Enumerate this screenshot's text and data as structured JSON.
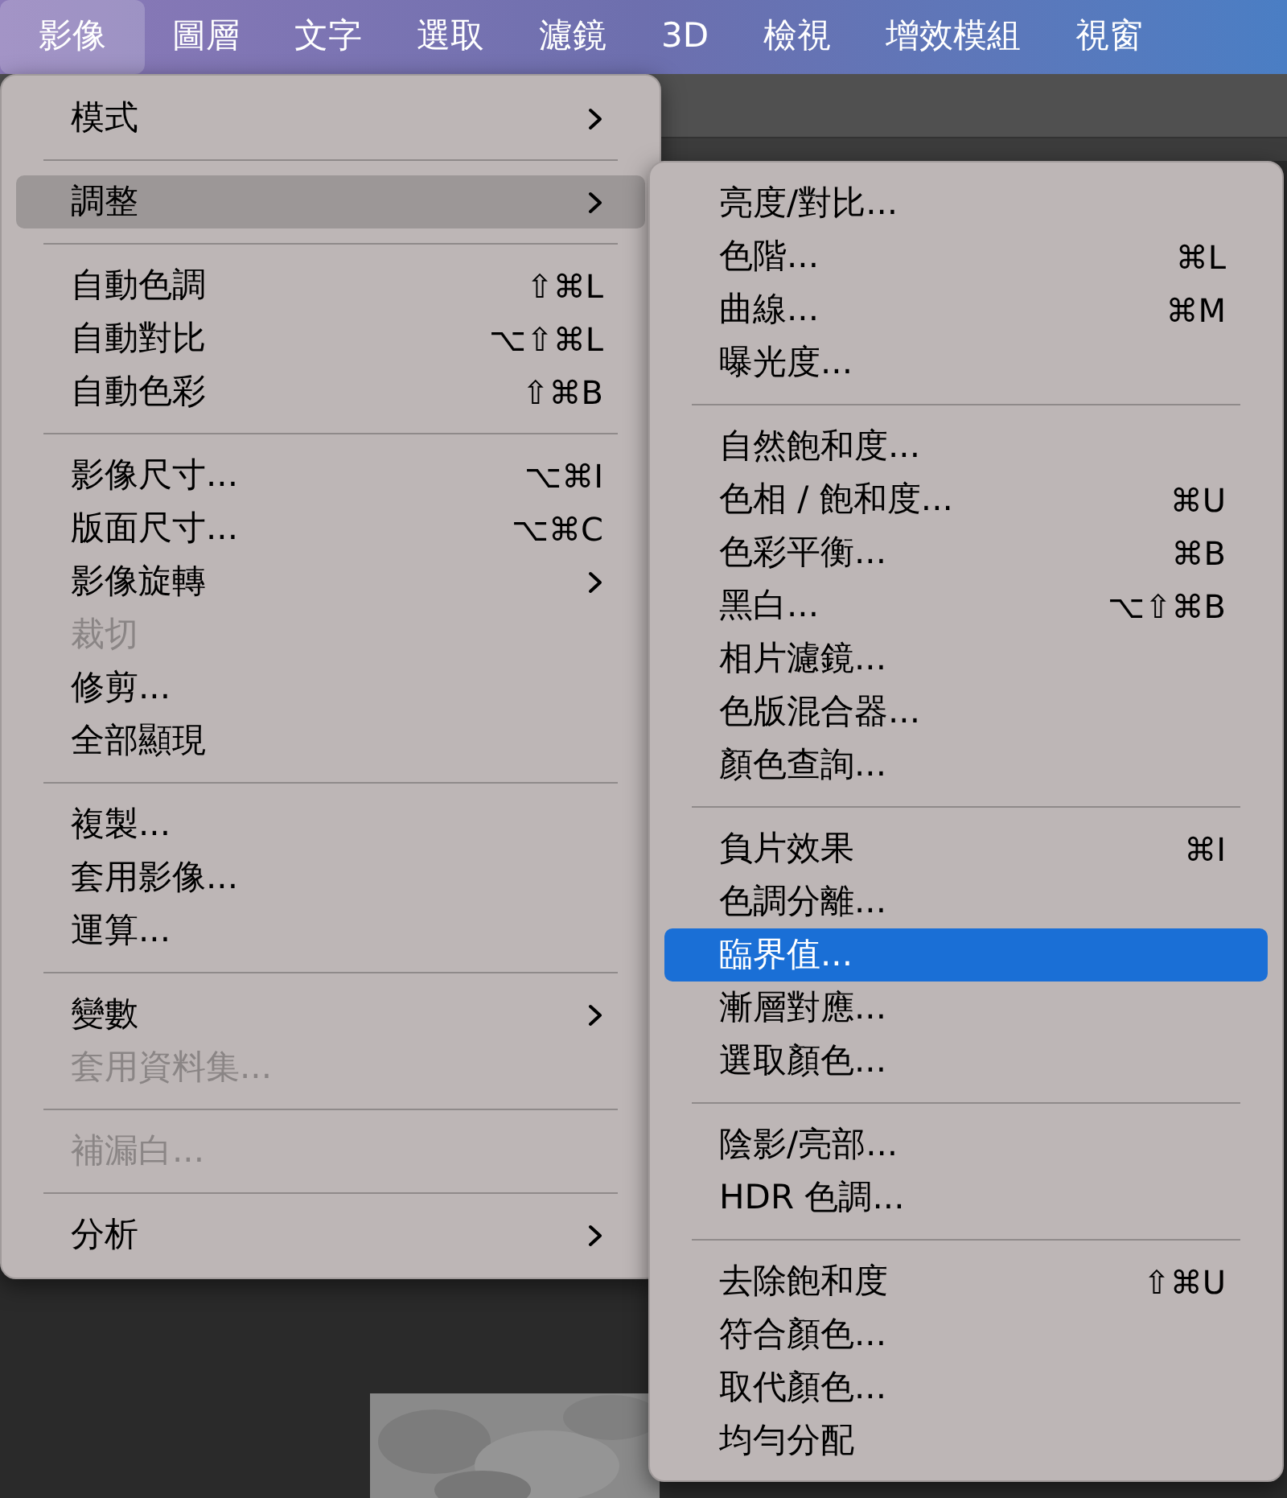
{
  "menu_bar": [
    {
      "label": "影像",
      "selected": true
    },
    {
      "label": "圖層",
      "selected": false
    },
    {
      "label": "文字",
      "selected": false
    },
    {
      "label": "選取",
      "selected": false
    },
    {
      "label": "濾鏡",
      "selected": false
    },
    {
      "label": "3D",
      "selected": false
    },
    {
      "label": "檢視",
      "selected": false
    },
    {
      "label": "增效模組",
      "selected": false
    },
    {
      "label": "視窗",
      "selected": false
    }
  ],
  "menu": {
    "items": [
      {
        "kind": "item",
        "label": "模式",
        "has_submenu": true,
        "selected": false,
        "disabled": false
      },
      {
        "kind": "separator"
      },
      {
        "kind": "item",
        "label": "調整",
        "has_submenu": true,
        "selected": true,
        "disabled": false
      },
      {
        "kind": "separator"
      },
      {
        "kind": "item",
        "label": "自動色調",
        "shortcut": "⇧⌘L",
        "selected": false,
        "disabled": false
      },
      {
        "kind": "item",
        "label": "自動對比",
        "shortcut": "⌥⇧⌘L",
        "selected": false,
        "disabled": false
      },
      {
        "kind": "item",
        "label": "自動色彩",
        "shortcut": "⇧⌘B",
        "selected": false,
        "disabled": false
      },
      {
        "kind": "separator"
      },
      {
        "kind": "item",
        "label": "影像尺寸...",
        "shortcut": "⌥⌘I",
        "selected": false,
        "disabled": false
      },
      {
        "kind": "item",
        "label": "版面尺寸...",
        "shortcut": "⌥⌘C",
        "selected": false,
        "disabled": false
      },
      {
        "kind": "item",
        "label": "影像旋轉",
        "has_submenu": true,
        "selected": false,
        "disabled": false
      },
      {
        "kind": "item",
        "label": "裁切",
        "selected": false,
        "disabled": true
      },
      {
        "kind": "item",
        "label": "修剪...",
        "selected": false,
        "disabled": false
      },
      {
        "kind": "item",
        "label": "全部顯現",
        "selected": false,
        "disabled": false
      },
      {
        "kind": "separator"
      },
      {
        "kind": "item",
        "label": "複製...",
        "selected": false,
        "disabled": false
      },
      {
        "kind": "item",
        "label": "套用影像...",
        "selected": false,
        "disabled": false
      },
      {
        "kind": "item",
        "label": "運算...",
        "selected": false,
        "disabled": false
      },
      {
        "kind": "separator"
      },
      {
        "kind": "item",
        "label": "變數",
        "has_submenu": true,
        "selected": false,
        "disabled": false
      },
      {
        "kind": "item",
        "label": "套用資料集...",
        "selected": false,
        "disabled": true
      },
      {
        "kind": "separator"
      },
      {
        "kind": "item",
        "label": "補漏白...",
        "selected": false,
        "disabled": true
      },
      {
        "kind": "separator"
      },
      {
        "kind": "item",
        "label": "分析",
        "has_submenu": true,
        "selected": false,
        "disabled": false
      }
    ]
  },
  "submenu": {
    "items": [
      {
        "kind": "item",
        "label": "亮度/對比...",
        "selected": false
      },
      {
        "kind": "item",
        "label": "色階...",
        "shortcut": "⌘L",
        "selected": false
      },
      {
        "kind": "item",
        "label": "曲線...",
        "shortcut": "⌘M",
        "selected": false
      },
      {
        "kind": "item",
        "label": "曝光度...",
        "selected": false
      },
      {
        "kind": "separator"
      },
      {
        "kind": "item",
        "label": "自然飽和度...",
        "selected": false
      },
      {
        "kind": "item",
        "label": "色相 / 飽和度...",
        "shortcut": "⌘U",
        "selected": false
      },
      {
        "kind": "item",
        "label": "色彩平衡...",
        "shortcut": "⌘B",
        "selected": false
      },
      {
        "kind": "item",
        "label": "黑白...",
        "shortcut": "⌥⇧⌘B",
        "selected": false
      },
      {
        "kind": "item",
        "label": "相片濾鏡...",
        "selected": false
      },
      {
        "kind": "item",
        "label": "色版混合器...",
        "selected": false
      },
      {
        "kind": "item",
        "label": "顏色查詢...",
        "selected": false
      },
      {
        "kind": "separator"
      },
      {
        "kind": "item",
        "label": "負片效果",
        "shortcut": "⌘I",
        "selected": false
      },
      {
        "kind": "item",
        "label": "色調分離...",
        "selected": false
      },
      {
        "kind": "item",
        "label": "臨界值...",
        "selected": true
      },
      {
        "kind": "item",
        "label": "漸層對應...",
        "selected": false
      },
      {
        "kind": "item",
        "label": "選取顏色...",
        "selected": false
      },
      {
        "kind": "separator"
      },
      {
        "kind": "item",
        "label": "陰影/亮部...",
        "selected": false
      },
      {
        "kind": "item",
        "label": "HDR 色調...",
        "selected": false
      },
      {
        "kind": "separator"
      },
      {
        "kind": "item",
        "label": "去除飽和度",
        "shortcut": "⇧⌘U",
        "selected": false
      },
      {
        "kind": "item",
        "label": "符合顏色...",
        "selected": false
      },
      {
        "kind": "item",
        "label": "取代顏色...",
        "selected": false
      },
      {
        "kind": "item",
        "label": "均勻分配",
        "selected": false
      }
    ]
  }
}
